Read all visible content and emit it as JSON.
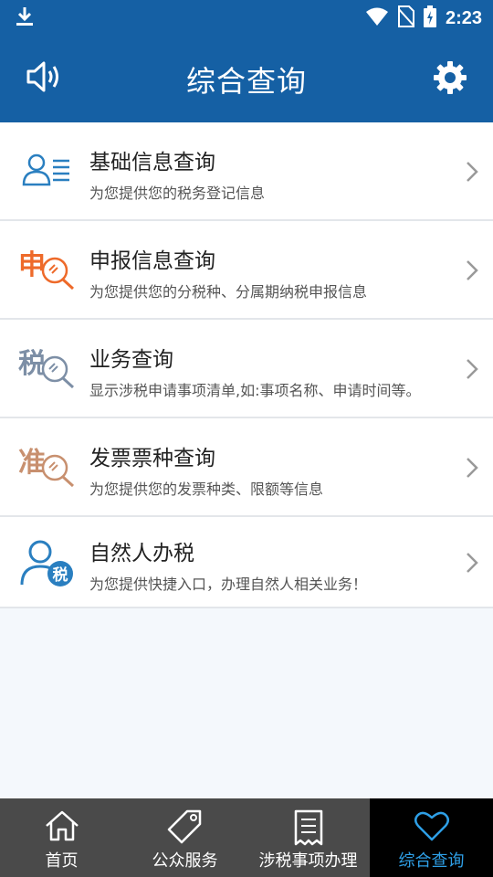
{
  "status_bar": {
    "time": "2:23"
  },
  "header": {
    "title": "综合查询"
  },
  "items": [
    {
      "title": "基础信息查询",
      "subtitle": "为您提供您的税务登记信息",
      "icon": "person-card-icon"
    },
    {
      "title": "申报信息查询",
      "subtitle": "为您提供您的分税种、分属期纳税申报信息",
      "icon": "declare-search-icon",
      "glyph": "申"
    },
    {
      "title": "业务查询",
      "subtitle": "显示涉税申请事项清单,如:事项名称、申请时间等。",
      "icon": "tax-search-icon",
      "glyph": "税"
    },
    {
      "title": "发票票种查询",
      "subtitle": "为您提供您的发票种类、限额等信息",
      "icon": "invoice-search-icon",
      "glyph": "准"
    },
    {
      "title": "自然人办税",
      "subtitle": "为您提供快捷入口，办理自然人相关业务！",
      "icon": "person-tax-icon",
      "glyph": "税"
    }
  ],
  "tabs": [
    {
      "label": "首页",
      "icon": "home-icon"
    },
    {
      "label": "公众服务",
      "icon": "tag-icon"
    },
    {
      "label": "涉税事项办理",
      "icon": "receipt-icon"
    },
    {
      "label": "综合查询",
      "icon": "heart-icon",
      "active": true
    }
  ],
  "colors": {
    "primary": "#1560a4",
    "active_tab": "#2e9fe6",
    "orange": "#ee6a2a",
    "tan": "#c8906f",
    "gray_blue": "#7d8fa6"
  }
}
